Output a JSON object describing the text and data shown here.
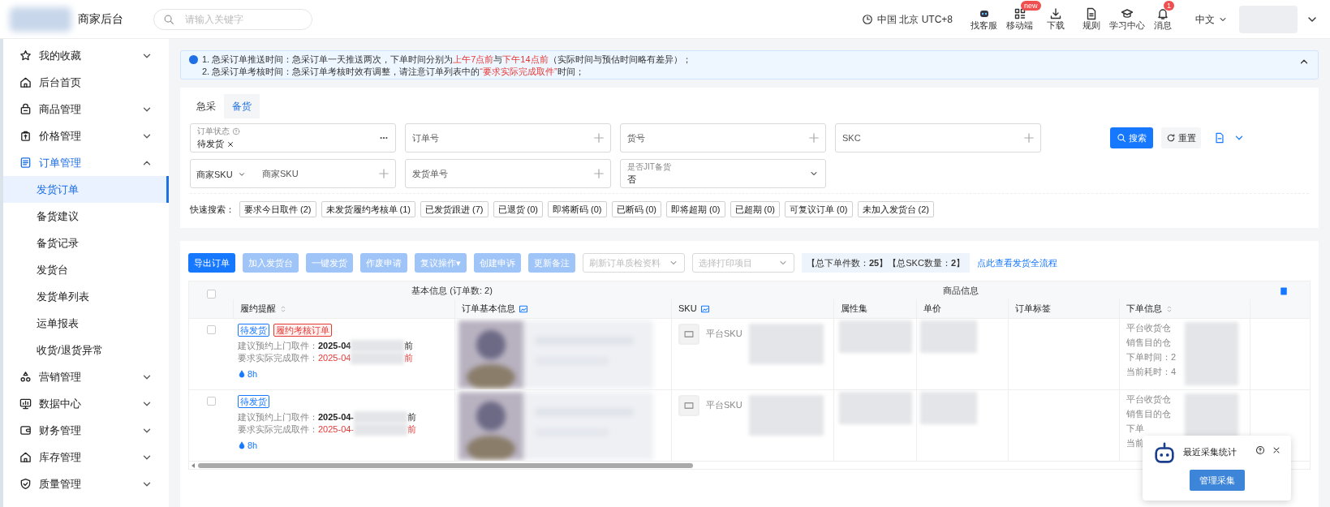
{
  "header": {
    "logo_text": "商家后台",
    "search_placeholder": "请输入关键字",
    "region": "中国 北京 UTC+8",
    "tools": [
      {
        "label": "找客服",
        "kind": "bot"
      },
      {
        "label": "移动端",
        "kind": "grid",
        "badge": "new"
      },
      {
        "label": "下载",
        "kind": "download"
      },
      {
        "label": "规则",
        "kind": "doc"
      },
      {
        "label": "学习中心",
        "kind": "cap"
      },
      {
        "label": "消息",
        "kind": "bell",
        "badge": "1"
      }
    ],
    "language": "中文"
  },
  "sidebar": {
    "items": [
      {
        "label": "我的收藏",
        "kind": "group",
        "expanded": false
      },
      {
        "label": "后台首页",
        "kind": "link"
      },
      {
        "label": "商品管理",
        "kind": "group",
        "expanded": false
      },
      {
        "label": "价格管理",
        "kind": "group",
        "expanded": false
      },
      {
        "label": "订单管理",
        "kind": "group",
        "expanded": true,
        "children": [
          {
            "label": "发货订单",
            "selected": true
          },
          {
            "label": "备货建议",
            "selected": false
          },
          {
            "label": "备货记录",
            "selected": false
          },
          {
            "label": "发货台",
            "selected": false
          },
          {
            "label": "发货单列表",
            "selected": false
          },
          {
            "label": "运单报表",
            "selected": false
          },
          {
            "label": "收货/退货异常",
            "selected": false
          }
        ]
      },
      {
        "label": "营销管理",
        "kind": "group",
        "expanded": false
      },
      {
        "label": "数据中心",
        "kind": "group",
        "expanded": false
      },
      {
        "label": "财务管理",
        "kind": "group",
        "expanded": false
      },
      {
        "label": "库存管理",
        "kind": "group",
        "expanded": false
      },
      {
        "label": "质量管理",
        "kind": "group",
        "expanded": false
      }
    ]
  },
  "notice": {
    "expanded": true,
    "lines": [
      [
        {
          "text": "1. 急采订单推送时间：急采订单一天推送两次，下单时间分别为",
          "highlight": false
        },
        {
          "text": "上午7点前",
          "highlight": true
        },
        {
          "text": "与",
          "highlight": false
        },
        {
          "text": "下午14点前",
          "highlight": true
        },
        {
          "text": "（实际时间与预估时间略有差异）；",
          "highlight": false
        }
      ],
      [
        {
          "text": "2. 急采订单考核时间：急采订单考核时效有调整，请注意订单列表中的",
          "highlight": false
        },
        {
          "text": "“要求实际完成取件”",
          "highlight": true
        },
        {
          "text": "时间；",
          "highlight": false
        }
      ]
    ]
  },
  "tabs": [
    {
      "label": "急采",
      "selected": false
    },
    {
      "label": "备货",
      "selected": true
    }
  ],
  "filters": [
    {
      "kind": "tags",
      "label": "订单状态",
      "tags": [
        "待发货"
      ]
    },
    {
      "kind": "text",
      "placeholder": "订单号"
    },
    {
      "kind": "text",
      "placeholder": "货号"
    },
    {
      "kind": "text",
      "placeholder": "SKC"
    },
    {
      "kind": "prefixed",
      "prefix": "商家SKU",
      "placeholder": "商家SKU"
    },
    {
      "kind": "text",
      "placeholder": "发货单号"
    },
    {
      "kind": "select",
      "label": "是否JIT备货",
      "value": "否"
    }
  ],
  "search_button": "搜索",
  "reset_button": "重置",
  "quick_search": {
    "label": "快速搜索：",
    "chips": [
      "要求今日取件 (2)",
      "未发货履约考核单 (1)",
      "已发货跟进 (7)",
      "已退货 (0)",
      "即将断码 (0)",
      "已断码 (0)",
      "即将超期 (0)",
      "已超期 (0)",
      "可复议订单 (0)",
      "未加入发货台 (2)"
    ]
  },
  "toolbar": {
    "buttons": [
      {
        "label": "导出订单",
        "disabled": false
      },
      {
        "label": "加入发货台",
        "disabled": true
      },
      {
        "label": "一键发货",
        "disabled": true
      },
      {
        "label": "作废申请",
        "disabled": true
      },
      {
        "label": "复议操作▾",
        "disabled": true
      },
      {
        "label": "创建申诉",
        "disabled": true
      },
      {
        "label": "更新备注",
        "disabled": true
      }
    ],
    "selects": [
      {
        "placeholder": "刷新订单质检资料"
      },
      {
        "placeholder": "选择打印项目"
      }
    ],
    "summary": "【总下单件数：**25**】【总SKC数量：**2**】",
    "link": "点此查看发货全流程"
  },
  "table": {
    "select_all_checked": false,
    "groups": [
      "基本信息 (订单数: 2)",
      "商品信息"
    ],
    "columns": [
      {
        "label": "履约提醒",
        "sortable": true,
        "toggle": false
      },
      {
        "label": "订单基本信息",
        "sortable": false,
        "toggle": true
      },
      {
        "label": "SKU",
        "sortable": false,
        "toggle": true
      },
      {
        "label": "属性集",
        "sortable": false,
        "toggle": false
      },
      {
        "label": "单价",
        "sortable": false,
        "toggle": false
      },
      {
        "label": "订单标签",
        "sortable": false,
        "toggle": false
      },
      {
        "label": "下单信息",
        "sortable": true,
        "toggle": false
      }
    ],
    "rows": [
      {
        "checked": false,
        "tags": [
          {
            "text": "待发货",
            "kind": "status"
          },
          {
            "text": "履约考核订单",
            "kind": "alert"
          }
        ],
        "pickup_label": "建议预约上门取件：",
        "pickup_date": "2025-04",
        "pickup_suffix": "前",
        "deadline_label": "要求实际完成取件：",
        "deadline_date": "2025-04",
        "deadline_suffix": "前",
        "timer": "8h",
        "sku_label": "平台SKU",
        "info": [
          "平台收货仓",
          "销售目的仓",
          "下单时间：2",
          "当前耗时：4"
        ]
      },
      {
        "checked": false,
        "tags": [
          {
            "text": "待发货",
            "kind": "status"
          }
        ],
        "pickup_label": "建议预约上门取件：",
        "pickup_date": "2025-04-",
        "pickup_suffix": "前",
        "deadline_label": "要求实际完成取件：",
        "deadline_date": "2025-04-",
        "deadline_suffix": "前",
        "timer": "8h",
        "sku_label": "平台SKU",
        "info": [
          "平台收货仓",
          "销售目的仓",
          "下单",
          "当前"
        ]
      }
    ]
  },
  "popup": {
    "title": "最近采集统计",
    "button": "管理采集"
  }
}
